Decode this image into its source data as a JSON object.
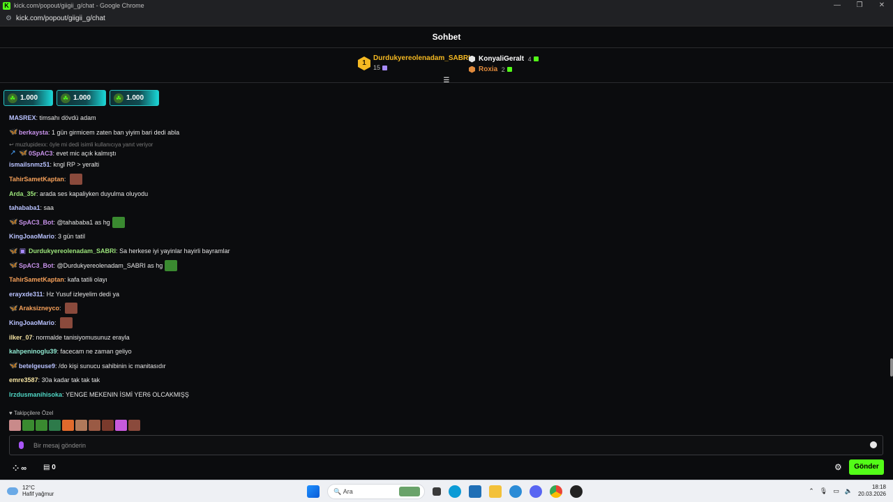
{
  "window": {
    "title": "kick.com/popout/giigii_g/chat - Google Chrome",
    "url": "kick.com/popout/giigii_g/chat"
  },
  "chat": {
    "header": "Sohbet",
    "leaderboard": {
      "first": {
        "rank": "1",
        "name": "Durdukyereolenadam_SABRI",
        "count": "15"
      },
      "others": [
        {
          "name": "KonyaliGeralt",
          "count": "4",
          "color": "#ffffff",
          "badge_color": "#e6e6e6"
        },
        {
          "name": "Roxia",
          "count": "2",
          "color": "#e08a3c",
          "badge_color": "#e08a3c"
        }
      ]
    },
    "pinned_gifts": [
      "1.000",
      "1.000",
      "1.000"
    ],
    "messages": [
      {
        "user": "MASREX",
        "text": "timsahı dövdü adam",
        "color": "#b9c2ff",
        "badges": [],
        "emotes": []
      },
      {
        "user": "berkaysta",
        "text": "1 gün girmicem zaten ban yiyim bari dedi abla",
        "color": "#c792ea",
        "badges": [
          "butterfly"
        ],
        "emotes": []
      },
      {
        "reply": "muzlupidexx: öyle mi dedi isimli kullanıcıya yanıt veriyor",
        "user": "0SpAC3",
        "text": "evet mic açık kalmıştı",
        "color": "#c792ea",
        "badges": [
          "arrow",
          "butterfly"
        ],
        "emotes": []
      },
      {
        "user": "ismailsnmz51",
        "text": "kngl RP > yeralti",
        "color": "#b9c2ff",
        "badges": [],
        "emotes": []
      },
      {
        "user": "TahirSametKaptan",
        "text": "",
        "color": "#f7a15a",
        "badges": [],
        "emotes": [
          "face"
        ]
      },
      {
        "user": "Arda_35r",
        "text": "arada ses kapaliyken duyulma oluyodu",
        "color": "#9be37a",
        "badges": [],
        "emotes": []
      },
      {
        "user": "tahababa1",
        "text": "saa",
        "color": "#b9c2ff",
        "badges": [],
        "emotes": []
      },
      {
        "user": "SpAC3_Bot",
        "text": "@tahababa1 as hg",
        "color": "#c792ea",
        "badges": [
          "butterfly"
        ],
        "emotes": [
          "pepe"
        ]
      },
      {
        "user": "KingJoaoMario",
        "text": "3 gün tatil",
        "color": "#b9c2ff",
        "badges": [],
        "emotes": []
      },
      {
        "user": "Durdukyereolenadam_SABRI",
        "text": "Sa herkese iyi yayinlar hayirli bayramlar",
        "color": "#9be37a",
        "badges": [
          "butterfly",
          "gift"
        ],
        "emotes": []
      },
      {
        "user": "SpAC3_Bot",
        "text": "@Durdukyereolenadam_SABRI as hg",
        "color": "#c792ea",
        "badges": [
          "butterfly"
        ],
        "emotes": [
          "pepe"
        ]
      },
      {
        "user": "TahirSametKaptan",
        "text": "kafa tatili olayı",
        "color": "#f7a15a",
        "badges": [],
        "emotes": []
      },
      {
        "user": "erayxde311",
        "text": "Hz Yusuf izleyelim dedi ya",
        "color": "#b9c2ff",
        "badges": [],
        "emotes": []
      },
      {
        "user": "Araksizneyco",
        "text": "",
        "color": "#f7a15a",
        "badges": [
          "butterfly"
        ],
        "emotes": [
          "face"
        ]
      },
      {
        "user": "KingJoaoMario",
        "text": "",
        "color": "#b9c2ff",
        "badges": [],
        "emotes": [
          "face"
        ]
      },
      {
        "user": "ilker_07",
        "text": "normalde tanisiyomusunuz erayla",
        "color": "#f4e2a0",
        "badges": [],
        "emotes": []
      },
      {
        "user": "kahpeninoglu39",
        "text": "facecam ne zaman geliyo",
        "color": "#8fe8d0",
        "badges": [],
        "emotes": []
      },
      {
        "user": "betelgeuse9",
        "text": "/do kişi sunucu sahibinin ic manitasıdır",
        "color": "#b9c2ff",
        "badges": [
          "butterfly"
        ],
        "emotes": []
      },
      {
        "user": "emre3587",
        "text": "30a kadar tak tak tak",
        "color": "#f4e2a0",
        "badges": [],
        "emotes": []
      },
      {
        "user": "Irzdusmanihisoka",
        "text": "YENGE MEKENIN İSMİ YER6 OLCAKMIŞŞ",
        "color": "#4fd6c4",
        "badges": [],
        "emotes": []
      }
    ],
    "followers_label": "Takipçilere Özel",
    "follower_emote_colors": [
      "#c98a8a",
      "#3a8a30",
      "#3a8a30",
      "#2d7a4a",
      "#e06a2c",
      "#b0795a",
      "#9a5a44",
      "#7a3a2c",
      "#c85adb",
      "#8a4a3c"
    ],
    "input_placeholder": "Bir mesaj gönderin",
    "infinity_label": "∞",
    "store_count": "0",
    "send_label": "Gönder",
    "accent": "#53fc18"
  },
  "taskbar": {
    "weather_temp": "12°C",
    "weather_desc": "Hafif yağmur",
    "search_placeholder": "Ara",
    "time": "18:18",
    "date": "20.03.2026"
  }
}
